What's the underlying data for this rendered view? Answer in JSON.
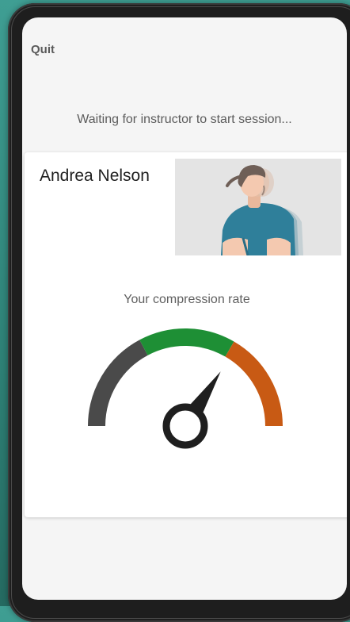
{
  "header": {
    "quit_label": "Quit"
  },
  "status": {
    "waiting_text": "Waiting for instructor to start session..."
  },
  "student": {
    "name": "Andrea Nelson",
    "avatar_icon": "person-compressions-illustration"
  },
  "compression": {
    "label": "Your compression rate",
    "gauge_icon": "speedometer-gauge-icon",
    "zones": [
      {
        "name": "too-slow",
        "color": "#4a4a4a"
      },
      {
        "name": "target",
        "color": "#1e8f35"
      },
      {
        "name": "too-fast",
        "color": "#c85a14"
      }
    ],
    "needle_value": 0.75
  },
  "colors": {
    "background": "#2f8378",
    "card": "#ffffff",
    "screen": "#f5f5f5",
    "avatar_shirt": "#2f7f9a"
  }
}
